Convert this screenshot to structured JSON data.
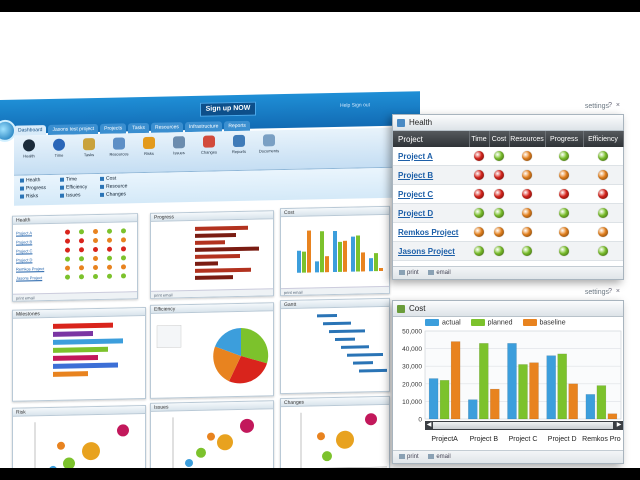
{
  "colors": {
    "blue": "#3c9edc",
    "green": "#7cc22c",
    "orange": "#e8831f",
    "red": "#d9241c",
    "header_dark": "#2f3337",
    "link": "#1d5fa8"
  },
  "app": {
    "signup_label": "Sign up NOW",
    "top_links": "Help  Sign out",
    "tabs": [
      "Dashboard",
      "Jasons test project",
      "Projects",
      "Tasks",
      "Resources",
      "Infrastructure",
      "Reports"
    ],
    "ribbon": [
      "Health",
      "Time",
      "Tasks",
      "Resources",
      "Risks",
      "Issues",
      "Changes",
      "Reports",
      "Documents"
    ],
    "quick_links": [
      "Health",
      "Time",
      "Cost",
      "Progress",
      "Efficiency",
      "Resource",
      "Risks",
      "Issues",
      "Changes"
    ],
    "widgets": [
      {
        "title": "Health",
        "foot": "print  email"
      },
      {
        "title": "Progress",
        "foot": "print  email"
      },
      {
        "title": "Cost",
        "foot": "print  email"
      },
      {
        "title": "Milestones",
        "foot": "print  email"
      },
      {
        "title": "Efficiency",
        "foot": "print  email"
      },
      {
        "title": "Gantt",
        "foot": "print  email"
      },
      {
        "title": "Risk",
        "foot": "print  email"
      },
      {
        "title": "Issues",
        "foot": "print  email"
      },
      {
        "title": "Changes",
        "foot": "print  email"
      }
    ]
  },
  "health_panel": {
    "settings_label": "settings",
    "controls": "? ×",
    "title": "Health",
    "columns": [
      "Project",
      "Time",
      "Cost",
      "Resources",
      "Progress",
      "Efficiency"
    ],
    "rows": [
      {
        "name": "Project A",
        "status": [
          "red",
          "green",
          "orange",
          "green",
          "green"
        ]
      },
      {
        "name": "Project B",
        "status": [
          "red",
          "red",
          "orange",
          "orange",
          "orange"
        ]
      },
      {
        "name": "Project C",
        "status": [
          "red",
          "red",
          "red",
          "red",
          "red"
        ]
      },
      {
        "name": "Project D",
        "status": [
          "green",
          "green",
          "orange",
          "green",
          "green"
        ]
      },
      {
        "name": "Remkos Project",
        "status": [
          "orange",
          "orange",
          "orange",
          "orange",
          "orange"
        ]
      },
      {
        "name": "Jasons Project",
        "status": [
          "green",
          "green",
          "green",
          "green",
          "green"
        ]
      }
    ],
    "footer": {
      "print": "print",
      "email": "email"
    }
  },
  "cost_panel": {
    "settings_label": "settings",
    "controls": "? ×",
    "title": "Cost",
    "footer": {
      "print": "print",
      "email": "email"
    }
  },
  "chart_data": {
    "type": "bar",
    "categories": [
      "Project A",
      "Project B",
      "Project C",
      "Project D",
      "Remkos Project"
    ],
    "tick_labels": [
      "ProjectA",
      "Project B",
      "Project C",
      "Project D",
      "Remkos Pro"
    ],
    "series": [
      {
        "name": "actual",
        "color": "#3c9edc",
        "values": [
          23000,
          11000,
          43000,
          36000,
          14000
        ]
      },
      {
        "name": "planned",
        "color": "#7cc22c",
        "values": [
          22000,
          43000,
          31000,
          37000,
          19000
        ]
      },
      {
        "name": "baseline",
        "color": "#e8831f",
        "values": [
          44000,
          17000,
          32000,
          20000,
          3000
        ]
      }
    ],
    "yticks": [
      "0",
      "10,000",
      "20,000",
      "30,000",
      "40,000",
      "50,000"
    ],
    "ylim": [
      0,
      50000
    ],
    "legend_position": "top",
    "grid": true
  }
}
